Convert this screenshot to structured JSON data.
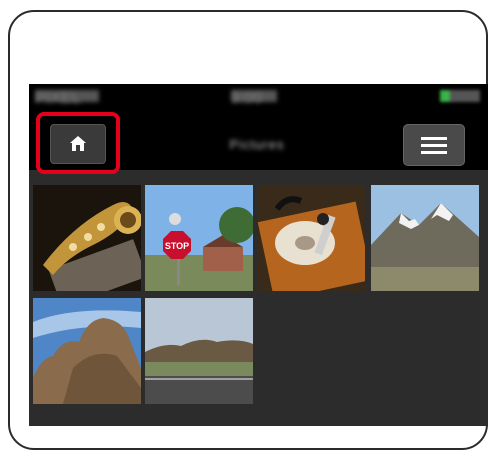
{
  "app": {
    "title": "Pictures"
  },
  "toolbar": {
    "home_icon": "home-icon",
    "menu_icon": "hamburger-menu-icon"
  },
  "status_bar": {
    "carrier": "PIXEL",
    "time": "9:00"
  },
  "photos": [
    {
      "subject": "saxophone",
      "colors": [
        "#2a1f12",
        "#c79a3a"
      ]
    },
    {
      "subject": "stop-sign",
      "colors": [
        "#7fb3e8",
        "#c8102e"
      ]
    },
    {
      "subject": "record-player",
      "colors": [
        "#b5651d",
        "#e8e0d0"
      ]
    },
    {
      "subject": "snowy-mountains",
      "colors": [
        "#9cc0e2",
        "#6f6a54"
      ]
    },
    {
      "subject": "rock-formation",
      "colors": [
        "#4f86c8",
        "#8a6b4c"
      ]
    },
    {
      "subject": "desert-road",
      "colors": [
        "#b8c6d6",
        "#5a5a5a"
      ]
    }
  ]
}
